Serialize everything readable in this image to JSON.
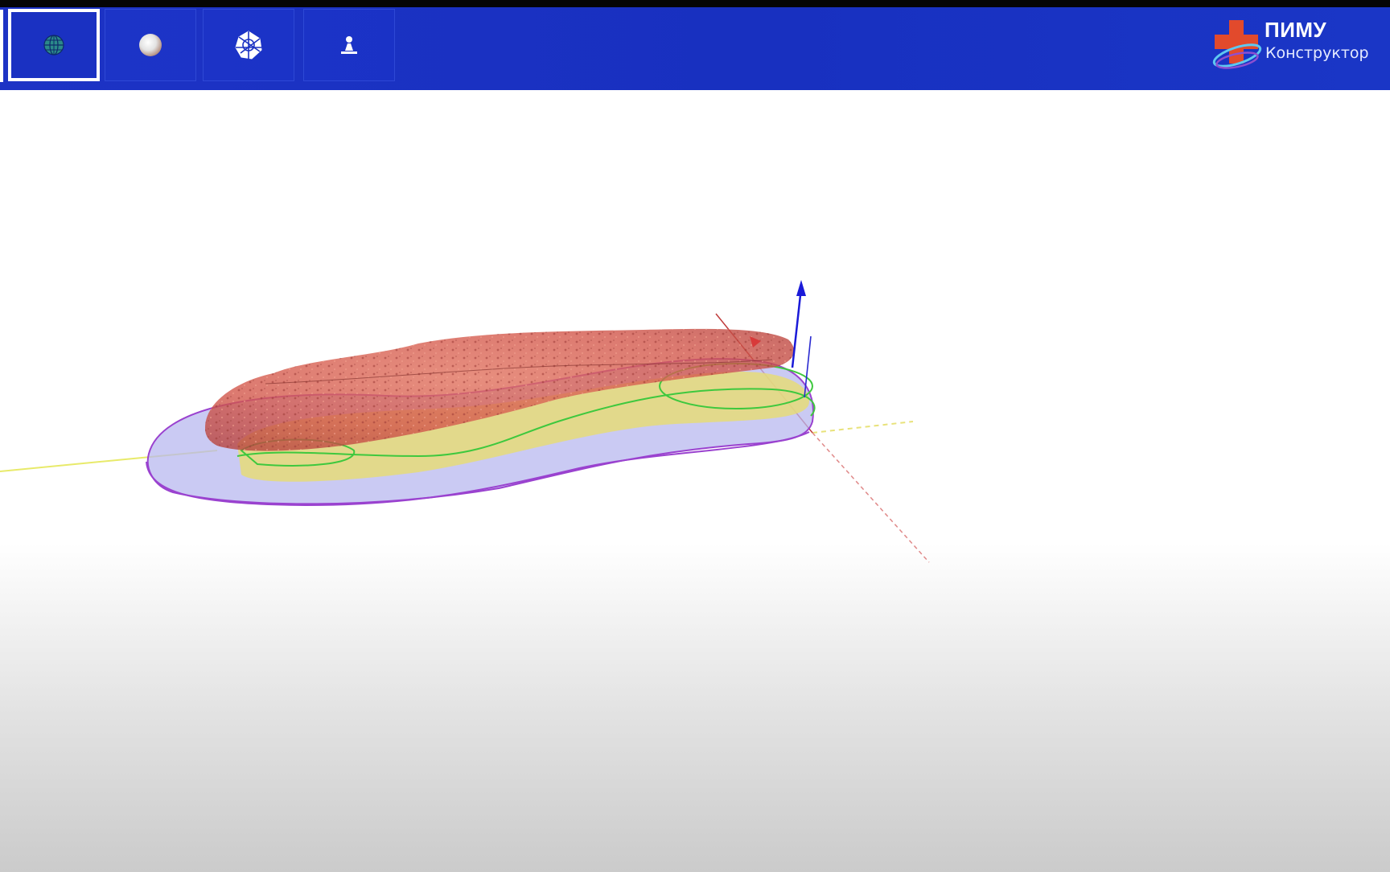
{
  "toolbar": {
    "buttons": [
      {
        "id": "wireframe",
        "icon": "wireframe-sphere-icon",
        "active": true
      },
      {
        "id": "shaded",
        "icon": "shaded-sphere-icon",
        "active": false
      },
      {
        "id": "mesh",
        "icon": "mesh-sphere-icon",
        "active": false
      },
      {
        "id": "marker",
        "icon": "marker-icon",
        "active": false
      }
    ]
  },
  "brand": {
    "title": "ПИМУ",
    "subtitle": "Конструктор",
    "logo_icon": "medical-cross-logo-icon"
  },
  "colors": {
    "toolbar": "#1a31c2",
    "foot_scan": "#d8564a",
    "insole_base": "#b9b9f0",
    "insole_layer": "#e9df7a",
    "contour_green": "#3ec83e",
    "axis_up": "#1a1ad8",
    "axis_red": "#d83a3a"
  }
}
